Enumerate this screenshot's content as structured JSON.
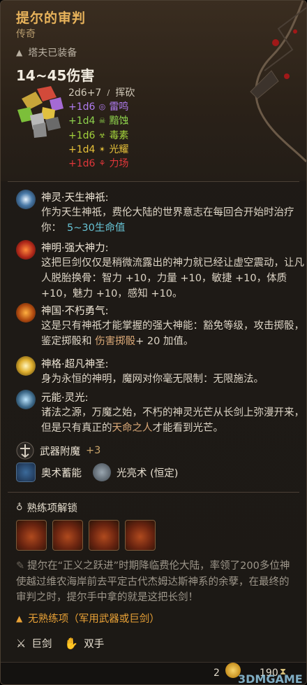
{
  "item": {
    "title": "提尔的审判",
    "rarity": "传奇",
    "equipped": "塔夫已装备",
    "damage": "14~45伤害",
    "damage_lines": [
      {
        "text": "2d6+7",
        "type": "挥砍",
        "color": "#d0c8b8",
        "icon": "slash-icon",
        "glyph": "∕"
      },
      {
        "text": "+1d6",
        "type": "雷鸣",
        "color": "#b07cf0",
        "icon": "thunder-icon",
        "glyph": "◎"
      },
      {
        "text": "+1d4",
        "type": "黯蚀",
        "color": "#8ed24d",
        "icon": "necrotic-icon",
        "glyph": "☠"
      },
      {
        "text": "+1d6",
        "type": "毒素",
        "color": "#a3d23c",
        "icon": "poison-icon",
        "glyph": "☣"
      },
      {
        "text": "+1d4",
        "type": "光耀",
        "color": "#e8c23a",
        "icon": "radiant-icon",
        "glyph": "✴"
      },
      {
        "text": "+1d6",
        "type": "力场",
        "color": "#e0373a",
        "icon": "force-icon",
        "glyph": "⚘"
      }
    ]
  },
  "abilities": [
    {
      "title": "神灵·天生神祇:",
      "desc_before": "作为天生神祇，费伦大陆的世界意志在每回合开始时治疗你：",
      "highlight": "5~30生命值",
      "highlight_color": "#66c3d4",
      "desc_after": ""
    },
    {
      "title": "神明·强大神力:",
      "desc_before": "这把巨剑仅仅是稍微流露出的神力就已经让虚空震动，让凡人脱胎换骨：智力 +10，力量 +10，敏捷 +10，体质 +10，魅力 +10，感知 +10。",
      "highlight": "",
      "highlight_color": "#ffffff",
      "desc_after": ""
    },
    {
      "title": "神国·不朽勇气:",
      "desc_before": "这是只有神祇才能掌握的强大神能：豁免等级，攻击掷骰，鉴定掷骰和 ",
      "highlight": "伤害掷骰",
      "highlight_color": "#d9a877",
      "desc_after": "+ 20 加值。"
    },
    {
      "title": "神格·超凡神圣:",
      "desc_before": "身为永恒的神明，魔网对你毫无限制：无限施法。",
      "highlight": "",
      "highlight_color": "#ffffff",
      "desc_after": ""
    },
    {
      "title": "元能·灵光:",
      "desc_before": "诸法之源，万魔之始，不朽的神灵光芒从长剑上弥漫开来，但是只有真正的",
      "highlight": "天命之人",
      "highlight_color": "#d9a877",
      "desc_after": "才能看到光芒。"
    }
  ],
  "enchant": {
    "label": "武器附魔",
    "bonus": "+3"
  },
  "spells": [
    {
      "label": "奥术蓄能"
    },
    {
      "label": "光亮术 (恒定)"
    }
  ],
  "proficiency": {
    "title": "熟练项解锁"
  },
  "lore": "提尔在“正义之跃进”时期降临费伦大陆，率领了200多位神使越过维农海岸前去平定古代杰姆达斯神系的余孽，在最终的审判之时，提尔手中拿的就是这把长剑！",
  "no_proficiency": "无熟练项（军用武器或巨剑）",
  "properties": [
    {
      "label": "巨剑",
      "icon": "greatsword-icon"
    },
    {
      "label": "双手",
      "icon": "two-handed-icon"
    }
  ],
  "footer": {
    "weight": "2",
    "price": "190"
  },
  "watermark": "3DMGAME"
}
